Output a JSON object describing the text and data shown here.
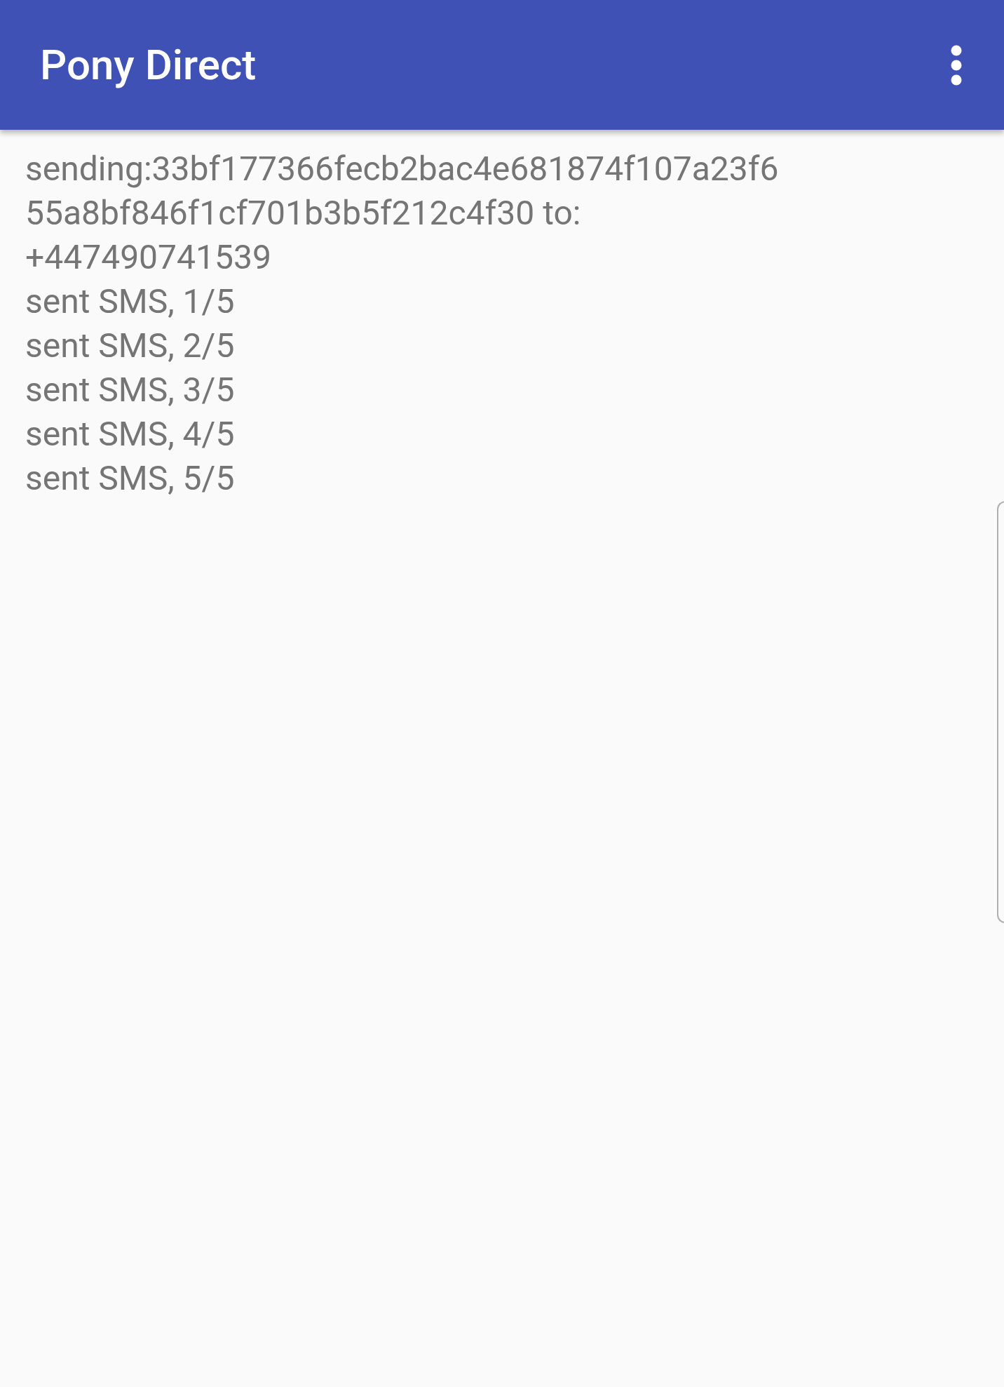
{
  "app_bar": {
    "title": "Pony Direct"
  },
  "log": [
    "sending:33bf177366fecb2bac4e681874f107a23f655a8bf846f1cf701b3b5f212c4f30 to: +447490741539",
    "sent SMS, 1/5",
    "sent SMS, 2/5",
    "sent SMS, 3/5",
    "sent SMS, 4/5",
    "sent SMS, 5/5"
  ]
}
